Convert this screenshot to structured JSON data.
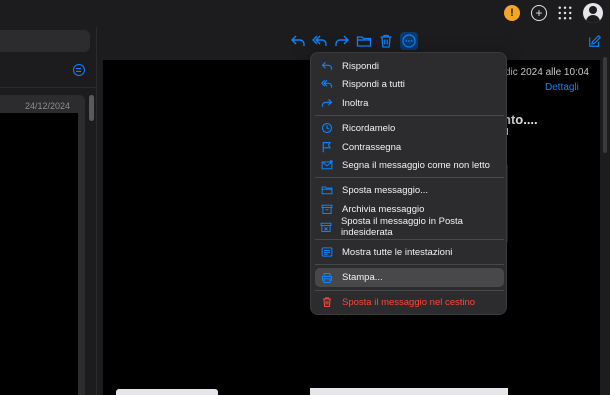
{
  "list": {
    "date": "24/12/2024"
  },
  "message": {
    "date": "dic 2024 alle 10:04",
    "details": "Dettagli",
    "subject_fragment": "nto...."
  },
  "menu": {
    "items": [
      {
        "label": "Rispondi",
        "icon": "reply-icon"
      },
      {
        "label": "Rispondi a tutti",
        "icon": "reply-all-icon"
      },
      {
        "label": "Inoltra",
        "icon": "forward-icon"
      },
      {
        "label": "Ricordamelo",
        "icon": "clock-icon"
      },
      {
        "label": "Contrassegna",
        "icon": "flag-icon"
      },
      {
        "label": "Segna il messaggio come non letto",
        "icon": "unread-envelope-icon"
      },
      {
        "label": "Sposta messaggio...",
        "icon": "folder-icon"
      },
      {
        "label": "Archivia messaggio",
        "icon": "archive-icon"
      },
      {
        "label": "Sposta il messaggio in Posta indesiderata",
        "icon": "junk-icon"
      },
      {
        "label": "Mostra tutte le intestazioni",
        "icon": "headers-icon"
      },
      {
        "label": "Stampa...",
        "icon": "print-icon"
      },
      {
        "label": "Sposta il messaggio nel cestino",
        "icon": "trash-icon"
      }
    ]
  },
  "colors": {
    "accent": "#0a84ff",
    "danger": "#ff453a",
    "warning": "#f5a623"
  }
}
